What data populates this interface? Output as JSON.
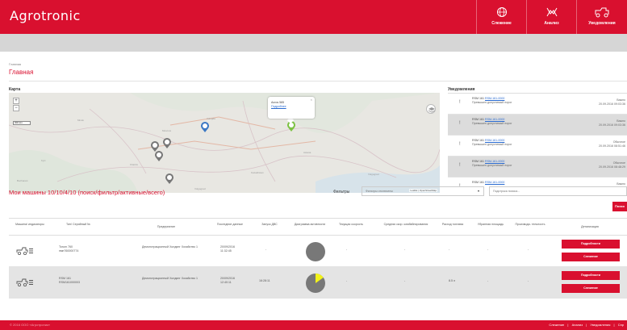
{
  "header": {
    "logo": "Agrotronic",
    "nav": [
      {
        "label": "Слежение",
        "icon": "globe-icon"
      },
      {
        "label": "Анализ",
        "icon": "analysis-icon"
      },
      {
        "label": "Уведомления",
        "icon": "tractor-icon"
      }
    ]
  },
  "breadcrumb": "Главная",
  "page_title": "Главная",
  "map": {
    "section_label": "Карта",
    "zoom_in": "+",
    "zoom_out": "−",
    "scale": "300 km",
    "popup_name": "Acros 585",
    "popup_link": "Подробнее",
    "popup_close": "×",
    "attribution": "Leaflet | OpenStreetMap"
  },
  "notifications": {
    "section_label": "Уведомления",
    "items": [
      {
        "head": "RSM 161",
        "link": "RSM-161-0000",
        "body": "Превышен допустимый порог",
        "status": "Важно",
        "date": "20.09.2016 09:03:36"
      },
      {
        "head": "RSM 161",
        "link": "RSM-161-0000",
        "body": "Превышен допустимый порог",
        "status": "Важно",
        "date": "20.09.2016 09:03:36"
      },
      {
        "head": "RSM 161",
        "link": "RSM-161-0000",
        "body": "Превышен допустимый порог",
        "status": "Обычное",
        "date": "20.09.2016 08:51:46"
      },
      {
        "head": "RSM 161",
        "link": "RSM-161-0000",
        "body": "Превышен допустимый порог",
        "status": "Обычное",
        "date": "20.09.2016 08:48:29"
      },
      {
        "head": "RSM 161",
        "link": "RSM-161-0000",
        "body": "",
        "status": "Важно",
        "date": ""
      }
    ]
  },
  "machines": {
    "title": "Мои машины 10/10/4/10 (поиск/фильтр/активные/всего)",
    "filter_label": "Фильтры",
    "filter_value": "Фильтры отключены",
    "filter_caret": "▾",
    "search_placeholder": "Подстрока поиска...",
    "search_button": "Поиск"
  },
  "table": {
    "columns": [
      "Машина/ индикаторы",
      "Тип/ Серийный №",
      "Предприятие",
      "Последние данные",
      "Запуск ДВС",
      "Диаграмма активности",
      "Текущая скорость",
      "Средняя скор. комбайнирования",
      "Расход топлива",
      "Убранная площадь",
      "Производи- тельность",
      "Детализация"
    ],
    "rows": [
      {
        "type": "Torum 760",
        "serial": "пмп760000774",
        "company": "Демонстрационный Холдинг Хозяйство 1",
        "last_data": "20/09/2016 11:32:45",
        "engine": "-",
        "speed": "-",
        "avg_speed": "-",
        "fuel": "-",
        "area": "-",
        "perf": "-",
        "btn1": "Подробности",
        "btn2": "Слежение"
      },
      {
        "type": "RSM 161",
        "serial": "RSM161000003",
        "company": "Демонстрационный Холдинг Хозяйство 1",
        "last_data": "20/09/2016 12:40:11",
        "engine": "16:28:11",
        "speed": "-",
        "avg_speed": "-",
        "fuel": "8.5 л",
        "area": "-",
        "perf": "-",
        "btn1": "Подробности",
        "btn2": "Слежение"
      }
    ],
    "pie_values": [
      0.0,
      0.15
    ],
    "pie_colors": [
      "#787878",
      "#f2f21a"
    ]
  },
  "footer": {
    "copyright": "© 2016 ООО «Агротроник»",
    "links": [
      "Слежение",
      "|",
      "Анализ",
      "|",
      "Уведомления",
      "|",
      "Спр"
    ]
  },
  "colors": {
    "accent": "#d9102f",
    "activity": "#f2f21a",
    "idle": "#787878"
  }
}
